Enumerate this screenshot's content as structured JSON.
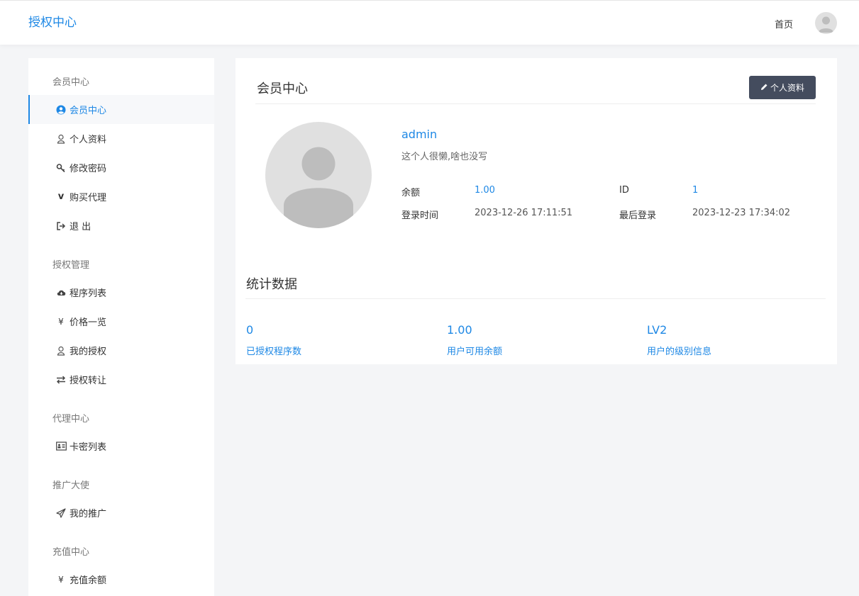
{
  "header": {
    "brand": "授权中心",
    "home_link": "首页"
  },
  "sidebar": {
    "sections": [
      {
        "title": "会员中心",
        "items": [
          {
            "label": "会员中心",
            "icon": "user-circle-icon",
            "active": true
          },
          {
            "label": "个人资料",
            "icon": "user-icon"
          },
          {
            "label": "修改密码",
            "icon": "key-icon"
          },
          {
            "label": "购买代理",
            "icon": "vimeo-v-icon"
          },
          {
            "label": "退 出",
            "icon": "sign-out-icon"
          }
        ]
      },
      {
        "title": "授权管理",
        "items": [
          {
            "label": "程序列表",
            "icon": "cloud-download-icon"
          },
          {
            "label": "价格一览",
            "icon": "yen-icon"
          },
          {
            "label": "我的授权",
            "icon": "user-icon"
          },
          {
            "label": "授权转让",
            "icon": "exchange-icon"
          }
        ]
      },
      {
        "title": "代理中心",
        "items": [
          {
            "label": "卡密列表",
            "icon": "id-card-icon"
          }
        ]
      },
      {
        "title": "推广大使",
        "items": [
          {
            "label": "我的推广",
            "icon": "paper-plane-icon"
          }
        ]
      },
      {
        "title": "充值中心",
        "items": [
          {
            "label": "充值余额",
            "icon": "yen-icon"
          }
        ]
      }
    ]
  },
  "profile": {
    "panel_title": "会员中心",
    "edit_button": "个人资料",
    "username": "admin",
    "bio": "这个人很懒,啥也没写",
    "fields": {
      "balance_label": "余额",
      "balance_value": "1.00",
      "id_label": "ID",
      "id_value": "1",
      "login_time_label": "登录时间",
      "login_time_value": "2023-12-26 17:11:51",
      "last_login_label": "最后登录",
      "last_login_value": "2023-12-23 17:34:02"
    }
  },
  "stats": {
    "title": "统计数据",
    "items": [
      {
        "value": "0",
        "label": "已授权程序数"
      },
      {
        "value": "1.00",
        "label": "用户可用余额"
      },
      {
        "value": "LV2",
        "label": "用户的级别信息"
      }
    ]
  },
  "colors": {
    "accent": "#1e88e5",
    "button_bg": "#444c5e",
    "page_bg": "#f4f5f7"
  }
}
